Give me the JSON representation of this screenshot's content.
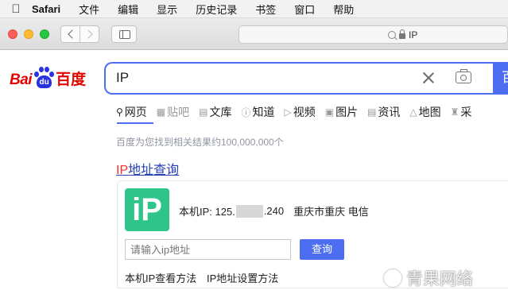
{
  "menubar": {
    "apple": "",
    "items": [
      "Safari",
      "文件",
      "编辑",
      "显示",
      "历史记录",
      "书签",
      "窗口",
      "帮助"
    ]
  },
  "toolbar": {
    "url": "IP"
  },
  "baidu": {
    "logo_bai": "Bai",
    "logo_du": "du",
    "logo_cn": "百度",
    "query": "IP",
    "search_button": "百",
    "tabs": [
      "网页",
      "贴吧",
      "文库",
      "知道",
      "视频",
      "图片",
      "资讯",
      "地图",
      "采"
    ],
    "result_count": "百度为您找到相关结果约100,000,000个",
    "result_title_hl": "IP",
    "result_title_rest": "地址查询",
    "ip_icon_text": "iP",
    "ip_label": "本机IP: 125.",
    "ip_tail": ".240",
    "ip_location": "重庆市重庆 电信",
    "ip_input_placeholder": "请输入ip地址",
    "ip_query_button": "查询",
    "link_check": "本机IP查看方法",
    "link_setting": "IP地址设置方法"
  },
  "watermark": "青果网络",
  "colors": {
    "baidu_blue": "#4e6ef2",
    "baidu_red": "#e10602",
    "ip_green": "#2fc58a"
  }
}
